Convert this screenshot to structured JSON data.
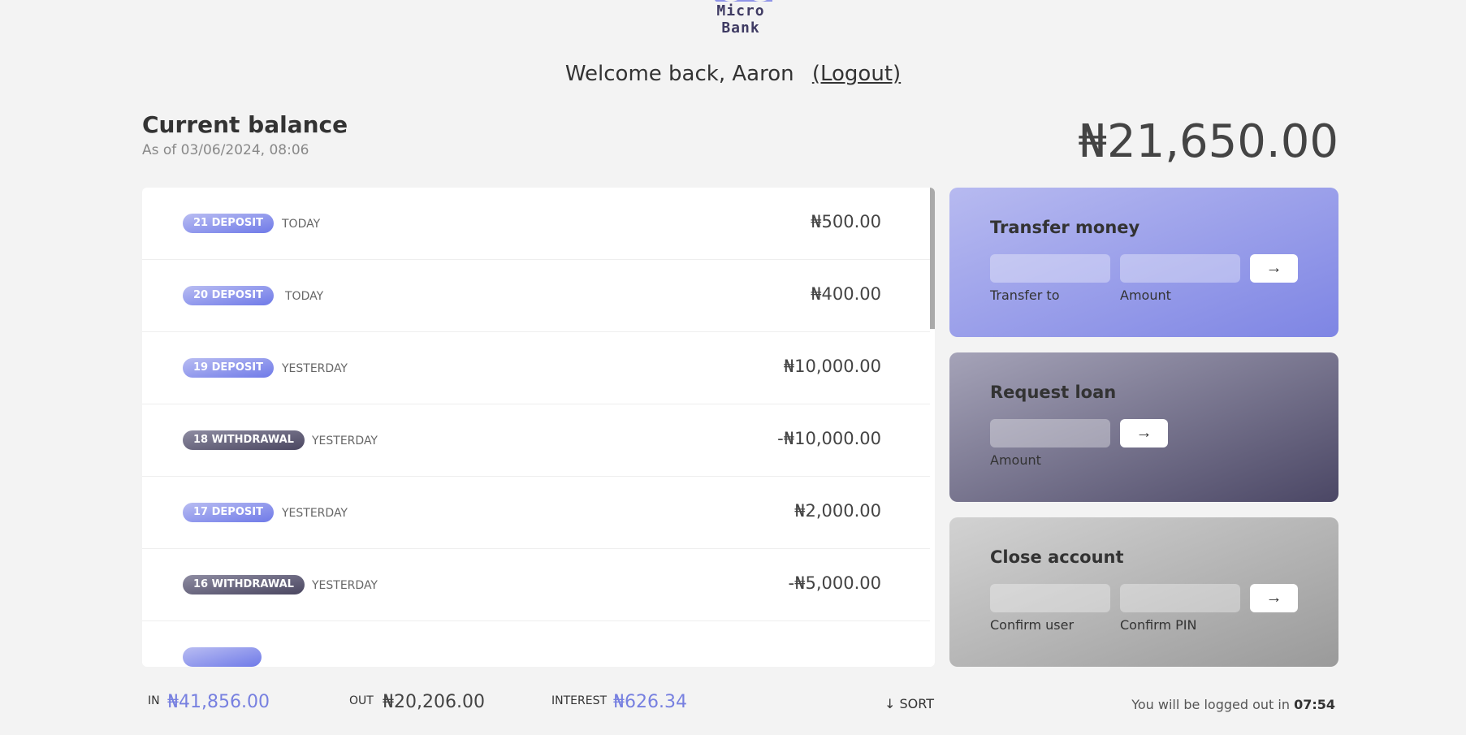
{
  "logo": {
    "text": "Micro Bank"
  },
  "welcome": {
    "message": "Welcome back, Aaron",
    "logout_label": "(Logout)"
  },
  "balance": {
    "title": "Current balance",
    "as_of": "As of 03/06/2024, 08:06",
    "value": "₦21,650.00"
  },
  "movements": [
    {
      "label": "21 DEPOSIT",
      "type": "deposit",
      "date": "TODAY",
      "value": "₦500.00"
    },
    {
      "label": "20 DEPOSIT",
      "type": "deposit",
      "date": "TODAY",
      "value": "₦400.00"
    },
    {
      "label": "19 DEPOSIT",
      "type": "deposit",
      "date": "YESTERDAY",
      "value": "₦10,000.00"
    },
    {
      "label": "18 WITHDRAWAL",
      "type": "withdrawal",
      "date": "YESTERDAY",
      "value": "-₦10,000.00"
    },
    {
      "label": "17 DEPOSIT",
      "type": "deposit",
      "date": "YESTERDAY",
      "value": "₦2,000.00"
    },
    {
      "label": "16 WITHDRAWAL",
      "type": "withdrawal",
      "date": "YESTERDAY",
      "value": "-₦5,000.00"
    }
  ],
  "operations": {
    "transfer": {
      "title": "Transfer money",
      "to_label": "Transfer to",
      "amount_label": "Amount",
      "button": "→"
    },
    "loan": {
      "title": "Request loan",
      "amount_label": "Amount",
      "button": "→"
    },
    "close": {
      "title": "Close account",
      "user_label": "Confirm user",
      "pin_label": "Confirm PIN",
      "button": "→"
    }
  },
  "summary": {
    "in_label": "In",
    "in_value": "₦41,856.00",
    "out_label": "Out",
    "out_value": "₦20,206.00",
    "interest_label": "Interest",
    "interest_value": "₦626.34",
    "sort_label": "↓ SORT"
  },
  "logout_timer": {
    "text": "You will be logged out in",
    "time": "07:54"
  },
  "colors": {
    "accent": "#7780e0",
    "deposit_badge": "#8a92ec",
    "withdrawal_badge": "#5d5a74"
  },
  "icons": {
    "submit": "arrow-right-icon",
    "sort": "arrow-down-icon"
  }
}
